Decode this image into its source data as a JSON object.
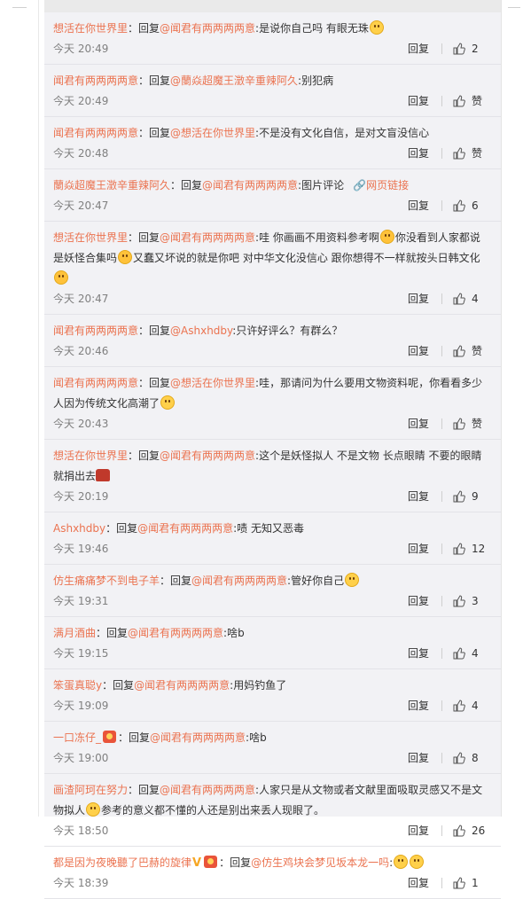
{
  "labels": {
    "reply": "回复",
    "reply_prefix": "：回复",
    "at": "@",
    "colon": ":"
  },
  "colors": {
    "name": "#eb7350",
    "time": "#808080",
    "panel_bg": "#f2f2f5"
  },
  "replies": [
    {
      "author": "想活在你世界里",
      "target": "@闻君有两两两两意",
      "text": "是说你自己吗 有眼无珠",
      "time": "今天 20:49",
      "reply_label": "回复",
      "likes": "2"
    },
    {
      "author": "闻君有两两两两意",
      "target": "@蘭焱超魔王澂辛重辣阿久",
      "text": "别犯病",
      "time": "今天 20:49",
      "reply_label": "回复",
      "likes": "赞"
    },
    {
      "author": "闻君有两两两两意",
      "target": "@想活在你世界里",
      "text": "不是没有文化自信，是对文盲没信心",
      "time": "今天 20:48",
      "reply_label": "回复",
      "likes": "赞"
    },
    {
      "author": "蘭焱超魔王澂辛重辣阿久",
      "target": "@闻君有两两两两意",
      "text": "图片评论",
      "link": "网页链接",
      "time": "今天 20:47",
      "reply_label": "回复",
      "likes": "6"
    },
    {
      "author": "想活在你世界里",
      "target": "@闻君有两两两两意",
      "text": "哇 你画画不用资料参考啊",
      "text2": "你没看到人家都说是妖怪合集吗",
      "text3": "又蠢又坏说的就是你吧 对中华文化没信心 跟你想得不一样就按头日韩文化",
      "time": "今天 20:47",
      "reply_label": "回复",
      "likes": "4"
    },
    {
      "author": "闻君有两两两两意",
      "target": "@Ashxhdby",
      "text": "只许好评么？有群么？",
      "time": "今天 20:46",
      "reply_label": "回复",
      "likes": "赞"
    },
    {
      "author": "闻君有两两两两意",
      "target": "@想活在你世界里",
      "text": "哇，那请问为什么要用文物资料呢，你看看多少人因为传统文化高潮了",
      "time": "今天 20:43",
      "reply_label": "回复",
      "likes": "赞"
    },
    {
      "author": "想活在你世界里",
      "target": "@闻君有两两两两意",
      "text": "这个是妖怪拟人 不是文物 长点眼睛 不要的眼睛就捐出去",
      "time": "今天 20:19",
      "reply_label": "回复",
      "likes": "9"
    },
    {
      "author": "Ashxhdby",
      "target": "@闻君有两两两两意",
      "text": "啧 无知又恶毒",
      "time": "今天 19:46",
      "reply_label": "回复",
      "likes": "12"
    },
    {
      "author": "仿生痛痛梦不到电子羊",
      "target": "@闻君有两两两两意",
      "text": "管好你自己",
      "time": "今天 19:31",
      "reply_label": "回复",
      "likes": "3"
    },
    {
      "author": "满月酒曲",
      "target": "@闻君有两两两两意",
      "text": "啥b",
      "time": "今天 19:15",
      "reply_label": "回复",
      "likes": "4"
    },
    {
      "author": "笨蛋真聪y",
      "target": "@闻君有两两两两意",
      "text": "用妈钓鱼了",
      "time": "今天 19:09",
      "reply_label": "回复",
      "likes": "4"
    },
    {
      "author": "一口冻仔_",
      "target": "@闻君有两两两两意",
      "text": "啥b",
      "time": "今天 19:00",
      "reply_label": "回复",
      "likes": "8"
    },
    {
      "author": "画渣阿珂在努力",
      "target": "@闻君有两两两两意",
      "text": "人家只是从文物或者文献里面吸取灵感又不是文物拟人",
      "text2": "参考的意义都不懂的人还是别出来丢人现眼了。",
      "time": "今天 18:50",
      "reply_label": "回复",
      "likes": "26"
    },
    {
      "author": "都是因为夜晚聽了巴赫的旋律",
      "target": "@仿生鸡块会梦见坂本龙一吗",
      "text": "",
      "time": "今天 18:39",
      "reply_label": "回复",
      "likes": "1"
    }
  ]
}
